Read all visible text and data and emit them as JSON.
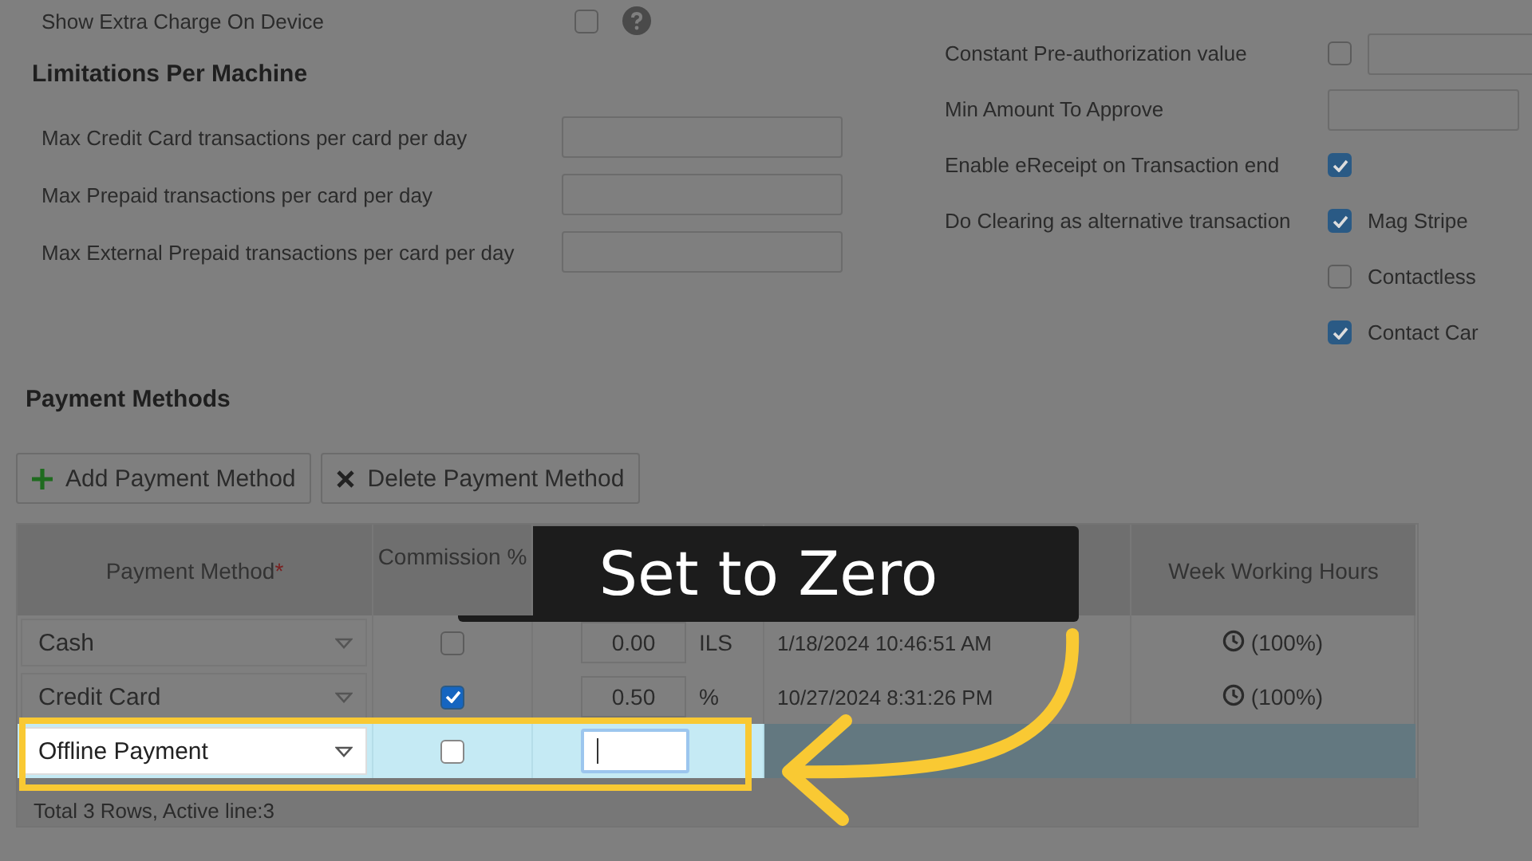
{
  "extra_charge": {
    "label": "Show Extra Charge On Device",
    "checked": false
  },
  "limitations": {
    "title": "Limitations Per Machine",
    "fields": [
      {
        "label": "Max Credit Card transactions per card per day"
      },
      {
        "label": "Max Prepaid transactions per card per day"
      },
      {
        "label": "Max External Prepaid transactions per card per day"
      }
    ]
  },
  "settings": [
    {
      "kind": "check_input",
      "label": "Constant Pre-authorization value",
      "checked": false
    },
    {
      "kind": "input",
      "label": "Min Amount To Approve"
    },
    {
      "kind": "check",
      "label": "Enable eReceipt on Transaction end",
      "checked": true
    },
    {
      "kind": "options",
      "label": "Do Clearing as alternative transaction",
      "options": [
        {
          "label": "Mag Stripe",
          "checked": true
        },
        {
          "label": "Contactless",
          "checked": false
        },
        {
          "label": "Contact Car",
          "checked": true
        }
      ]
    }
  ],
  "payment_methods": {
    "title": "Payment Methods",
    "buttons": [
      {
        "kind": "add",
        "label": "Add Payment Method"
      },
      {
        "kind": "delete",
        "label": "Delete Payment Method"
      }
    ],
    "table": {
      "columns": [
        {
          "label": "Payment Method",
          "required_mark": "*"
        },
        {
          "label": "Commission %"
        },
        {},
        {},
        {
          "label": "Week Working Hours"
        }
      ],
      "rows": [
        {
          "method": "Cash",
          "commission": false,
          "charge": "0.00",
          "unit": "ILS",
          "date": "1/18/2024 10:46:51 AM",
          "hours": "(100%)",
          "selected": false,
          "editing": false
        },
        {
          "method": "Credit Card",
          "commission": true,
          "charge": "0.50",
          "unit": "%",
          "date": "10/27/2024 8:31:26 PM",
          "hours": "(100%)",
          "selected": false,
          "editing": false
        },
        {
          "method": "Offline Payment",
          "commission": false,
          "selected": true,
          "editing": true
        }
      ],
      "footer": "Total 3 Rows, Active line:3"
    }
  },
  "callout": {
    "text": "Set to Zero"
  }
}
